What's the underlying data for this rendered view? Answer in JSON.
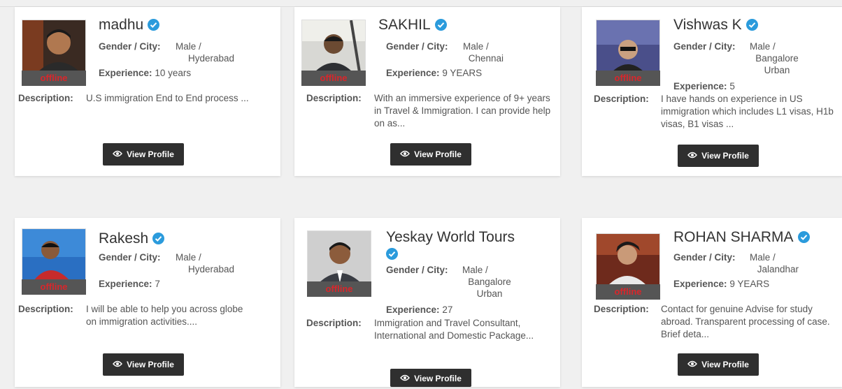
{
  "labels": {
    "gender_city": "Gender / City:",
    "experience": "Experience:",
    "description": "Description:",
    "view_profile": "View Profile",
    "status": "offline"
  },
  "profiles": [
    {
      "name": "madhu",
      "gender": "Male /",
      "city": "Hyderabad",
      "experience": "10 years",
      "description": "U.S immigration End to End process ..."
    },
    {
      "name": "SAKHIL",
      "gender": "Male /",
      "city": "Chennai",
      "experience": "9 YEARS",
      "description": "With an immersive experience of 9+ years in Travel & Immigration. I can provide help on as..."
    },
    {
      "name": "Vishwas K",
      "gender": "Male /",
      "city": "Bangalore Urban",
      "experience": "5",
      "description": "I have hands on experience in US immigration which includes L1 visas, H1b visas, B1 visas ..."
    },
    {
      "name": "Rakesh",
      "gender": "Male /",
      "city": "Hyderabad",
      "experience": "7",
      "description": "I will be able to help you across globe on immigration activities...."
    },
    {
      "name": "Yeskay World Tours",
      "gender": "Male /",
      "city": "Bangalore Urban",
      "experience": "27",
      "description": "Immigration and Travel Consultant, International and Domestic Package..."
    },
    {
      "name": "ROHAN SHARMA",
      "gender": "Male /",
      "city": "Jalandhar",
      "experience": "9 YEARS",
      "description": "Contact for genuine Advise for study abroad. Transparent processing of case. Brief deta..."
    }
  ],
  "icons": {
    "verified": "verified-check-icon",
    "view": "eye-icon"
  },
  "colors": {
    "verified": "#2b9bdc",
    "offline": "#d9262b",
    "button": "#2f2f2f"
  }
}
